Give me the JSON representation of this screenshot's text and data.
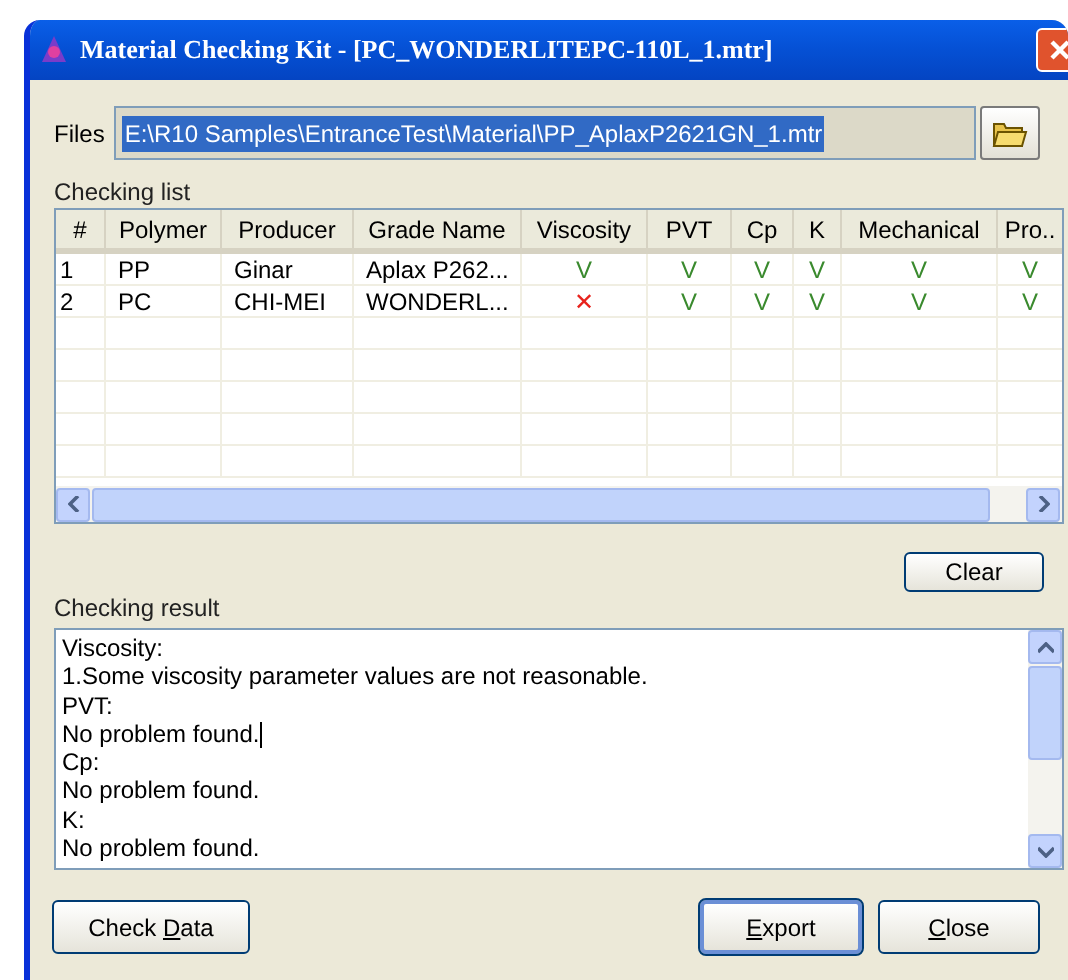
{
  "window": {
    "title": "Material Checking Kit - [PC_WONDERLITEPC-110L_1.mtr]"
  },
  "files": {
    "label": "Files",
    "value": "E:\\R10 Samples\\EntranceTest\\Material\\PP_AplaxP2621GN_1.mtr",
    "selected": true
  },
  "checking_list": {
    "label": "Checking list",
    "columns": [
      "#",
      "Polymer",
      "Producer",
      "Grade Name",
      "Viscosity",
      "PVT",
      "Cp",
      "K",
      "Mechanical",
      "Pro.."
    ],
    "rows": [
      {
        "cells": [
          {
            "kind": "text",
            "text": "1"
          },
          {
            "kind": "text",
            "text": "PP"
          },
          {
            "kind": "text",
            "text": "Ginar"
          },
          {
            "kind": "text",
            "text": "Aplax P262..."
          },
          {
            "kind": "check",
            "text": "V",
            "ok": true
          },
          {
            "kind": "check",
            "text": "V",
            "ok": true
          },
          {
            "kind": "check",
            "text": "V",
            "ok": true
          },
          {
            "kind": "check",
            "text": "V",
            "ok": true
          },
          {
            "kind": "check",
            "text": "V",
            "ok": true
          },
          {
            "kind": "check",
            "text": "V",
            "ok": true
          }
        ]
      },
      {
        "cells": [
          {
            "kind": "text",
            "text": "2"
          },
          {
            "kind": "text",
            "text": "PC"
          },
          {
            "kind": "text",
            "text": "CHI-MEI"
          },
          {
            "kind": "text",
            "text": "WONDERL..."
          },
          {
            "kind": "check",
            "text": "✕",
            "ok": false
          },
          {
            "kind": "check",
            "text": "V",
            "ok": true
          },
          {
            "kind": "check",
            "text": "V",
            "ok": true
          },
          {
            "kind": "check",
            "text": "V",
            "ok": true
          },
          {
            "kind": "check",
            "text": "V",
            "ok": true
          },
          {
            "kind": "check",
            "text": "V",
            "ok": true
          }
        ]
      }
    ]
  },
  "clear_button": {
    "label": "Clear"
  },
  "checking_result": {
    "label": "Checking result",
    "lines": [
      {
        "text": "Viscosity:",
        "caret": false
      },
      {
        "text": "1.Some viscosity parameter values are not reasonable.",
        "caret": false
      },
      {
        "text": "PVT:",
        "caret": false
      },
      {
        "text": "No problem found.",
        "caret": true
      },
      {
        "text": "Cp:",
        "caret": false
      },
      {
        "text": "No problem found.",
        "caret": false
      },
      {
        "text": "K:",
        "caret": false
      },
      {
        "text": "No problem found.",
        "caret": false
      }
    ]
  },
  "buttons": [
    {
      "label_before": "Check ",
      "access_key": "D",
      "label_after": "ata",
      "default": false
    },
    {
      "access_key": "E",
      "label_after": "xport",
      "default": true
    },
    {
      "access_key": "C",
      "label_after": "lose",
      "default": false
    }
  ]
}
